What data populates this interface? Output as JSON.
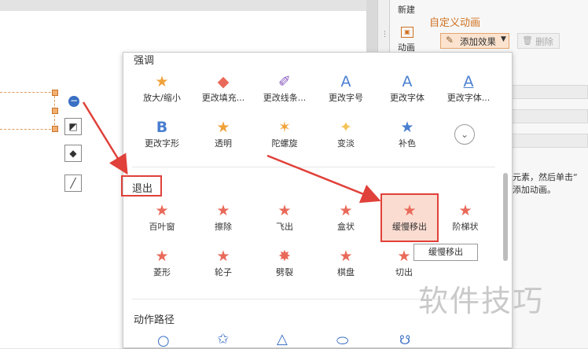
{
  "sidebar": {
    "top_label": "新建",
    "anim_label": "动画",
    "title": "自定义动画",
    "add_effect": "添加效果",
    "delete": "删除",
    "hint_line1": "元素，然后单击“",
    "hint_line2": "添加动画。"
  },
  "panel": {
    "emphasis_title": "强调",
    "emphasis_row1": [
      "放大/缩小",
      "更改填充...",
      "更改线条...",
      "更改字号",
      "更改字体",
      "更改字体..."
    ],
    "emphasis_row2": [
      "更改字形",
      "透明",
      "陀螺旋",
      "变淡",
      "补色"
    ],
    "exit_title": "退出",
    "exit_row1": [
      "百叶窗",
      "擦除",
      "飞出",
      "盒状",
      "缓慢移出",
      "阶梯状"
    ],
    "exit_row2": [
      "菱形",
      "轮子",
      "劈裂",
      "棋盘",
      "切出"
    ],
    "path_title": "动作路径",
    "tooltip": "缓慢移出"
  },
  "watermark": "软件技巧",
  "colors": {
    "accent": "#e0413a",
    "star": "#f0a23a",
    "exit_star": "#e96a5a",
    "blue_icon": "#4a7fd0"
  }
}
